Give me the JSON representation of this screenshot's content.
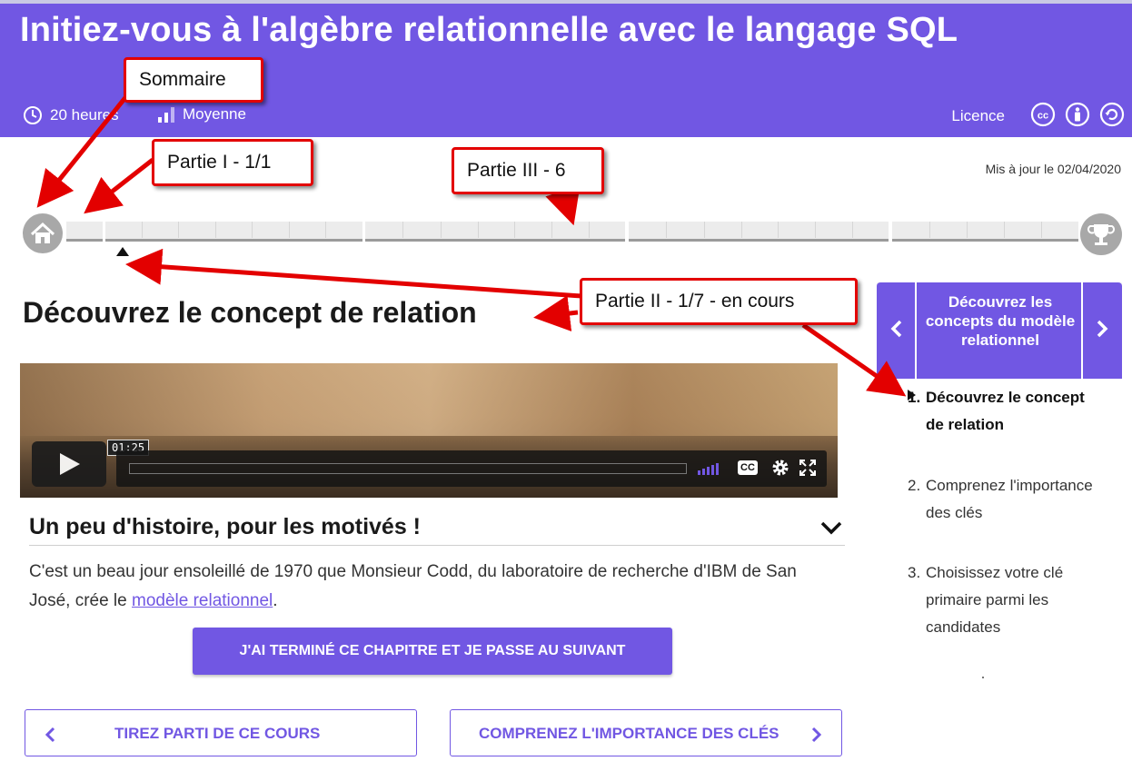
{
  "header": {
    "title": "Initiez-vous à l'algèbre relationnelle avec le langage SQL",
    "duration": "20 heures",
    "level": "Moyenne",
    "licence_label": "Licence",
    "licence_icons": [
      "cc-icon",
      "attribution-icon",
      "share-alike-icon"
    ],
    "accent_color": "#7157e3"
  },
  "updated": "Mis à jour le 02/04/2020",
  "progress": {
    "parts_segments": [
      1,
      7,
      6,
      6,
      6
    ],
    "current": "Partie II - 1/7"
  },
  "chapter": {
    "title": "Découvrez le concept de relation",
    "video": {
      "time_tooltip": "01:25",
      "cc_label": "CC"
    },
    "accordion_title": "Un peu d'histoire, pour les motivés !",
    "paragraph_before": "C'est un beau jour ensoleillé de 1970 que Monsieur Codd, du laboratoire de recherche d'IBM de San José, crée le ",
    "paragraph_link": "modèle relationnel",
    "paragraph_after": "."
  },
  "buttons": {
    "complete": "J'AI TERMINÉ CE CHAPITRE ET JE PASSE AU SUIVANT",
    "prev": "TIREZ PARTI DE CE COURS",
    "next": "COMPRENEZ L'IMPORTANCE DES CLÉS"
  },
  "sidebar": {
    "part_title": "Découvrez les concepts du modèle relationnel",
    "items": [
      {
        "num": "1.",
        "label": "Découvrez le concept de relation",
        "current": true
      },
      {
        "num": "2.",
        "label": "Comprenez l'importance des clés",
        "current": false
      },
      {
        "num": "3.",
        "label": "Choisissez votre clé primaire parmi les candidates",
        "current": false
      }
    ]
  },
  "annotations": {
    "sommaire": "Sommaire",
    "partie1": "Partie I - 1/1",
    "partie3": "Partie III - 6",
    "partie2": "Partie II - 1/7 - en cours",
    "color": "#e30000"
  }
}
